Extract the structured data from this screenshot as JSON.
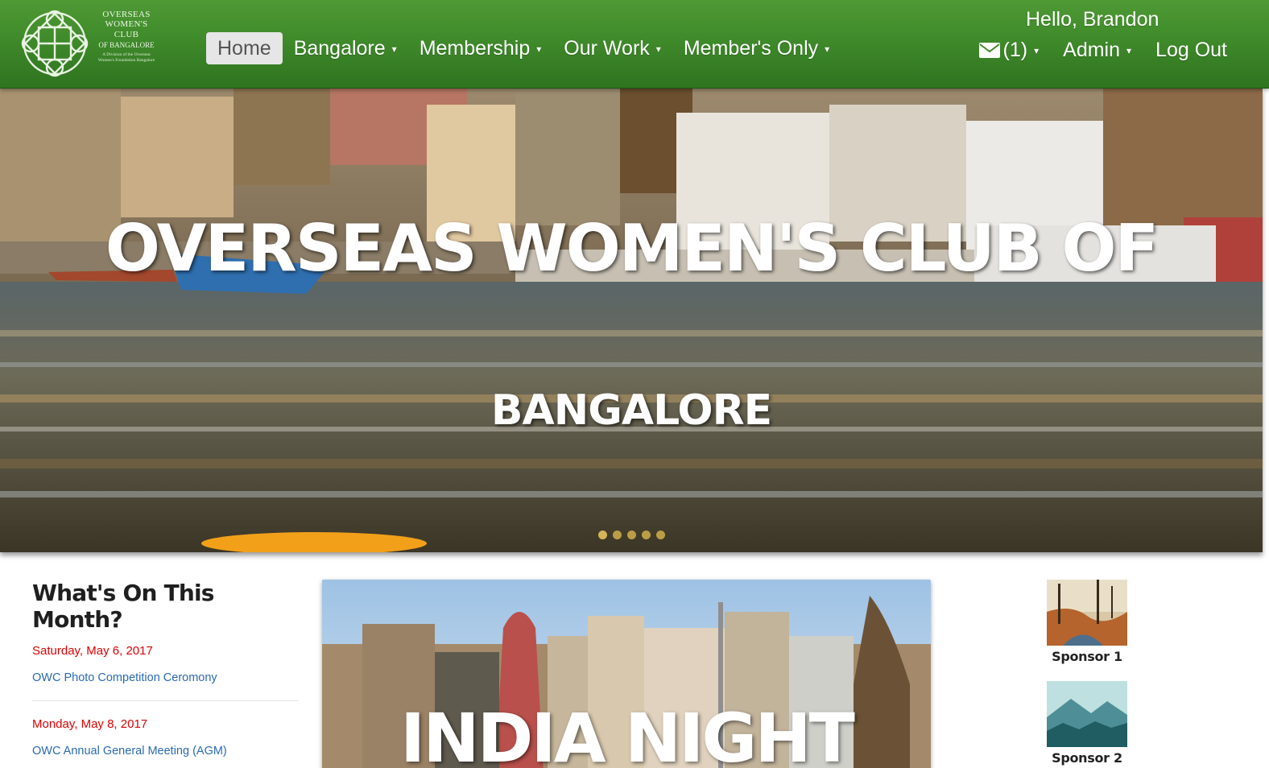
{
  "logo": {
    "line1": "OVERSEAS",
    "line2": "WOMEN'S",
    "line3": "CLUB",
    "line4": "OF BANGALORE",
    "line5": "A Division of the Overseas Women's Foundation Bangalore"
  },
  "nav": {
    "home": "Home",
    "bangalore": "Bangalore",
    "membership": "Membership",
    "our_work": "Our Work",
    "members_only": "Member's Only"
  },
  "user": {
    "greeting": "Hello, Brandon",
    "mail_count": "(1)",
    "admin": "Admin",
    "logout": "Log Out"
  },
  "hero": {
    "title": "OVERSEAS WOMEN'S CLUB OF",
    "subtitle": "BANGALORE",
    "slides": 5,
    "active_slide": 1
  },
  "events": {
    "heading": "What's On This Month?",
    "items": [
      {
        "date": "Saturday, May 6, 2017",
        "title": "OWC Photo Competition Ceromony"
      },
      {
        "date": "Monday, May 8, 2017",
        "title": "OWC Annual General Meeting (AGM)"
      }
    ]
  },
  "feature": {
    "title": "INDIA NIGHT"
  },
  "sponsors": [
    {
      "label": "Sponsor 1"
    },
    {
      "label": "Sponsor 2"
    }
  ],
  "colors": {
    "nav_green": "#3f8a2a",
    "event_date": "#e00000",
    "event_link": "#2a6ab4"
  }
}
